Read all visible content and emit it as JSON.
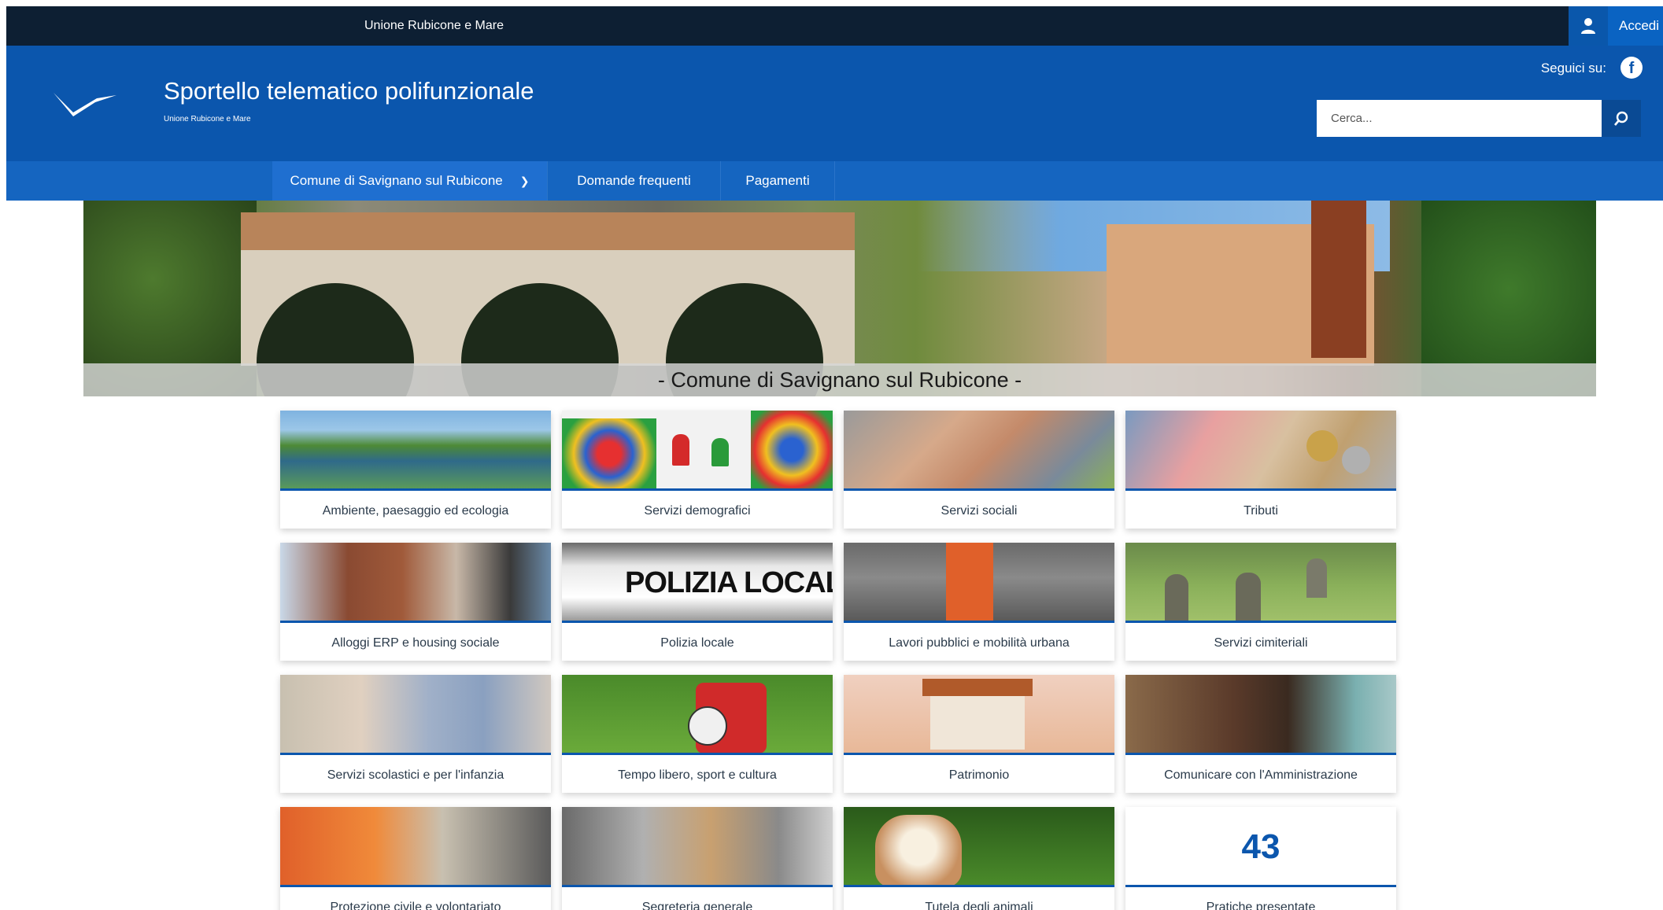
{
  "topbar": {
    "org_name": "Unione Rubicone e Mare",
    "login_label": "Accedi",
    "user_icon": "user-icon"
  },
  "header": {
    "title": "Sportello telematico polifunzionale",
    "subtitle": "Unione Rubicone e Mare",
    "follow_label": "Seguici su:",
    "social_icon": "facebook-icon",
    "search_placeholder": "Cerca...",
    "search_icon": "search-icon"
  },
  "nav": {
    "items": [
      {
        "label": "Comune di Savignano sul Rubicone",
        "has_dropdown": true
      },
      {
        "label": "Domande frequenti"
      },
      {
        "label": "Pagamenti"
      }
    ]
  },
  "hero": {
    "caption": "- Comune di Savignano sul Rubicone -"
  },
  "tiles": [
    {
      "label": "Ambiente, paesaggio ed ecologia"
    },
    {
      "label": "Servizi demografici"
    },
    {
      "label": "Servizi sociali"
    },
    {
      "label": "Tributi"
    },
    {
      "label": "Alloggi ERP e housing sociale"
    },
    {
      "label": "Polizia locale",
      "image_text": "POLIZIA LOCALE"
    },
    {
      "label": "Lavori pubblici e mobilità urbana"
    },
    {
      "label": "Servizi cimiteriali"
    },
    {
      "label": "Servizi scolastici e per l'infanzia"
    },
    {
      "label": "Tempo libero, sport e cultura"
    },
    {
      "label": "Patrimonio"
    },
    {
      "label": "Comunicare con l'Amministrazione"
    },
    {
      "label": "Protezione civile e volontariato"
    },
    {
      "label": "Segreteria generale"
    },
    {
      "label": "Tutela degli animali"
    },
    {
      "label": "Pratiche presentate",
      "count": "43"
    }
  ],
  "colors": {
    "topbar": "#0d1f33",
    "header": "#0b56ad",
    "nav": "#1565c0",
    "accent": "#0a63c2"
  }
}
